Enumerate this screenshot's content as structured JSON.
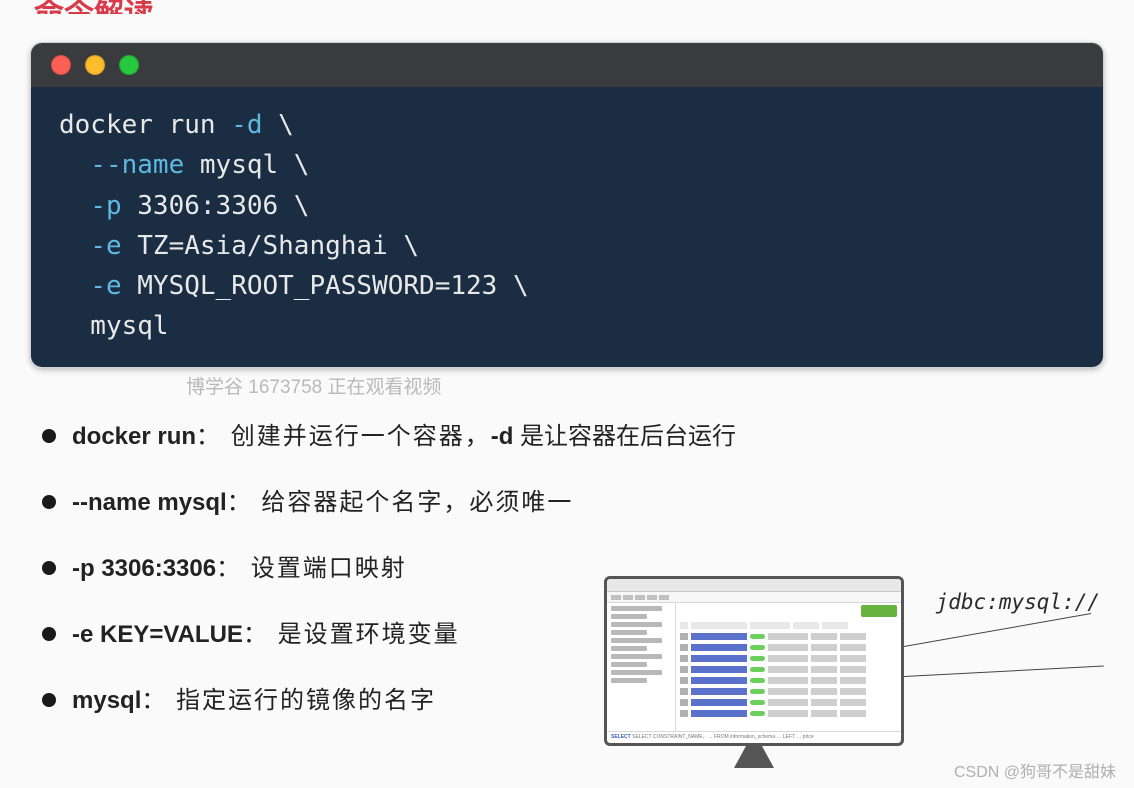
{
  "title": "命令解读",
  "terminal": {
    "lines": [
      {
        "indent": "",
        "pre": "docker run ",
        "flag": "-d",
        "post": " \\"
      },
      {
        "indent": "  ",
        "pre": "",
        "flag": "--name",
        "post": " mysql \\"
      },
      {
        "indent": "  ",
        "pre": "",
        "flag": "-p",
        "post": " 3306:3306 \\"
      },
      {
        "indent": "  ",
        "pre": "",
        "flag": "-e",
        "post": " TZ=Asia/Shanghai \\"
      },
      {
        "indent": "  ",
        "pre": "",
        "flag": "-e",
        "post": " MYSQL_ROOT_PASSWORD=123 \\"
      },
      {
        "indent": "  ",
        "pre": "mysql",
        "flag": "",
        "post": ""
      }
    ]
  },
  "watermark": "博学谷 1673758 正在观看视频",
  "bullets": [
    {
      "bold": "docker run",
      "rest": "： 创建并运行一个容器，",
      "bold2": "-d",
      "rest2": " 是让容器在后台运行"
    },
    {
      "bold": "--name mysql",
      "rest": "： 给容器起个名字，必须唯一",
      "bold2": "",
      "rest2": ""
    },
    {
      "bold": "-p 3306:3306",
      "rest": "： 设置端口映射",
      "bold2": "",
      "rest2": ""
    },
    {
      "bold": "-e KEY=VALUE",
      "rest": "： 是设置环境变量",
      "bold2": "",
      "rest2": ""
    },
    {
      "bold": "mysql",
      "rest": "： 指定运行的镜像的名字",
      "bold2": "",
      "rest2": ""
    }
  ],
  "diagram": {
    "label": "jdbc:mysql://",
    "sql": "SELECT CONSTRAINT_NAME，… FROM information_schema … LEFT … price"
  },
  "credit": "CSDN @狗哥不是甜妹"
}
